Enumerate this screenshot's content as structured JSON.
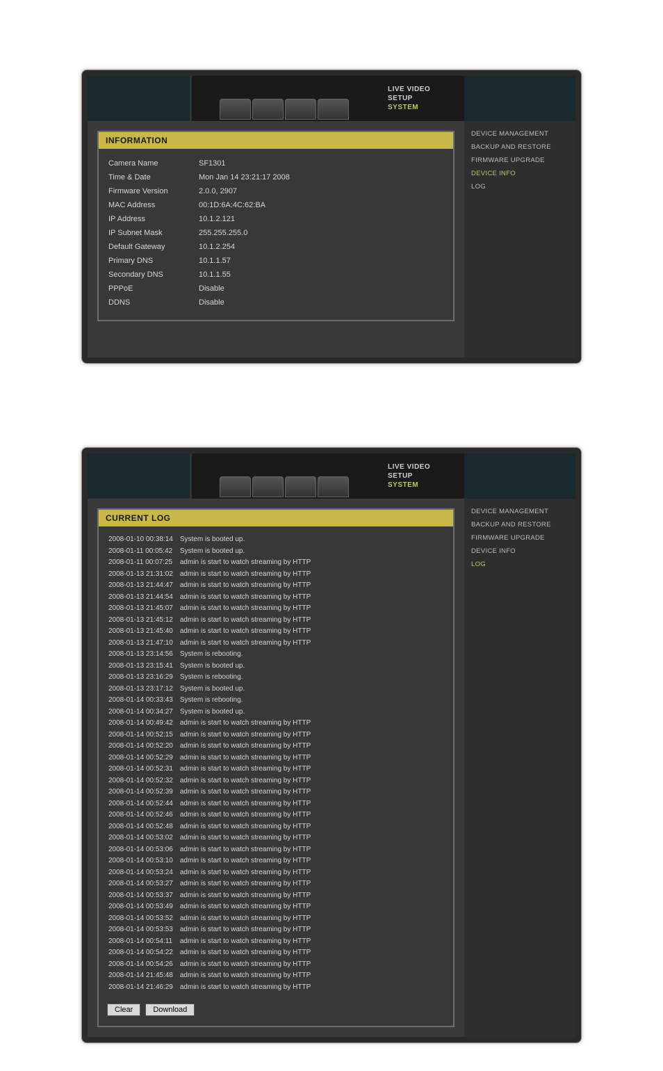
{
  "topnav": {
    "live": "LIVE VIDEO",
    "setup": "SETUP",
    "system": "SYSTEM"
  },
  "sidemenu": {
    "device_management": "DEVICE MANAGEMENT",
    "backup_restore": "BACKUP AND RESTORE",
    "firmware_upgrade": "FIRMWARE UPGRADE",
    "device_info": "DEVICE INFO",
    "log": "LOG"
  },
  "info": {
    "title": "INFORMATION",
    "rows": [
      {
        "k": "Camera Name",
        "v": "SF1301"
      },
      {
        "k": "Time & Date",
        "v": "Mon Jan 14 23:21:17 2008"
      },
      {
        "k": "Firmware Version",
        "v": "2.0.0, 2907"
      },
      {
        "k": "MAC Address",
        "v": "00:1D:6A:4C:62:BA"
      },
      {
        "k": "IP Address",
        "v": "10.1.2.121"
      },
      {
        "k": "IP Subnet Mask",
        "v": "255.255.255.0"
      },
      {
        "k": "Default Gateway",
        "v": "10.1.2.254"
      },
      {
        "k": "Primary DNS",
        "v": "10.1.1.57"
      },
      {
        "k": "Secondary DNS",
        "v": "10.1.1.55"
      },
      {
        "k": "PPPoE",
        "v": "Disable"
      },
      {
        "k": "DDNS",
        "v": "Disable"
      }
    ]
  },
  "log": {
    "title": "CURRENT LOG",
    "clear": "Clear",
    "download": "Download",
    "entries": [
      {
        "t": "2008-01-10 00:38:14",
        "m": "System is booted up."
      },
      {
        "t": "2008-01-11 00:05:42",
        "m": "System is booted up."
      },
      {
        "t": "2008-01-11 00:07:25",
        "m": "admin is start to watch streaming by HTTP"
      },
      {
        "t": "2008-01-13 21:31:02",
        "m": "admin is start to watch streaming by HTTP"
      },
      {
        "t": "2008-01-13 21:44:47",
        "m": "admin is start to watch streaming by HTTP"
      },
      {
        "t": "2008-01-13 21:44:54",
        "m": "admin is start to watch streaming by HTTP"
      },
      {
        "t": "2008-01-13 21:45:07",
        "m": "admin is start to watch streaming by HTTP"
      },
      {
        "t": "2008-01-13 21:45:12",
        "m": "admin is start to watch streaming by HTTP"
      },
      {
        "t": "2008-01-13 21:45:40",
        "m": "admin is start to watch streaming by HTTP"
      },
      {
        "t": "2008-01-13 21:47:10",
        "m": "admin is start to watch streaming by HTTP"
      },
      {
        "t": "2008-01-13 23:14:56",
        "m": "System is rebooting."
      },
      {
        "t": "2008-01-13 23:15:41",
        "m": "System is booted up."
      },
      {
        "t": "2008-01-13 23:16:29",
        "m": "System is rebooting."
      },
      {
        "t": "2008-01-13 23:17:12",
        "m": "System is booted up."
      },
      {
        "t": "2008-01-14 00:33:43",
        "m": "System is rebooting."
      },
      {
        "t": "2008-01-14 00:34:27",
        "m": "System is booted up."
      },
      {
        "t": "2008-01-14 00:49:42",
        "m": "admin is start to watch streaming by HTTP"
      },
      {
        "t": "2008-01-14 00:52:15",
        "m": "admin is start to watch streaming by HTTP"
      },
      {
        "t": "2008-01-14 00:52:20",
        "m": "admin is start to watch streaming by HTTP"
      },
      {
        "t": "2008-01-14 00:52:29",
        "m": "admin is start to watch streaming by HTTP"
      },
      {
        "t": "2008-01-14 00:52:31",
        "m": "admin is start to watch streaming by HTTP"
      },
      {
        "t": "2008-01-14 00:52:32",
        "m": "admin is start to watch streaming by HTTP"
      },
      {
        "t": "2008-01-14 00:52:39",
        "m": "admin is start to watch streaming by HTTP"
      },
      {
        "t": "2008-01-14 00:52:44",
        "m": "admin is start to watch streaming by HTTP"
      },
      {
        "t": "2008-01-14 00:52:46",
        "m": "admin is start to watch streaming by HTTP"
      },
      {
        "t": "2008-01-14 00:52:48",
        "m": "admin is start to watch streaming by HTTP"
      },
      {
        "t": "2008-01-14 00:53:02",
        "m": "admin is start to watch streaming by HTTP"
      },
      {
        "t": "2008-01-14 00:53:06",
        "m": "admin is start to watch streaming by HTTP"
      },
      {
        "t": "2008-01-14 00:53:10",
        "m": "admin is start to watch streaming by HTTP"
      },
      {
        "t": "2008-01-14 00:53:24",
        "m": "admin is start to watch streaming by HTTP"
      },
      {
        "t": "2008-01-14 00:53:27",
        "m": "admin is start to watch streaming by HTTP"
      },
      {
        "t": "2008-01-14 00:53:37",
        "m": "admin is start to watch streaming by HTTP"
      },
      {
        "t": "2008-01-14 00:53:49",
        "m": "admin is start to watch streaming by HTTP"
      },
      {
        "t": "2008-01-14 00:53:52",
        "m": "admin is start to watch streaming by HTTP"
      },
      {
        "t": "2008-01-14 00:53:53",
        "m": "admin is start to watch streaming by HTTP"
      },
      {
        "t": "2008-01-14 00:54:11",
        "m": "admin is start to watch streaming by HTTP"
      },
      {
        "t": "2008-01-14 00:54:22",
        "m": "admin is start to watch streaming by HTTP"
      },
      {
        "t": "2008-01-14 00:54:26",
        "m": "admin is start to watch streaming by HTTP"
      },
      {
        "t": "2008-01-14 21:45:48",
        "m": "admin is start to watch streaming by HTTP"
      },
      {
        "t": "2008-01-14 21:46:29",
        "m": "admin is start to watch streaming by HTTP"
      }
    ]
  }
}
